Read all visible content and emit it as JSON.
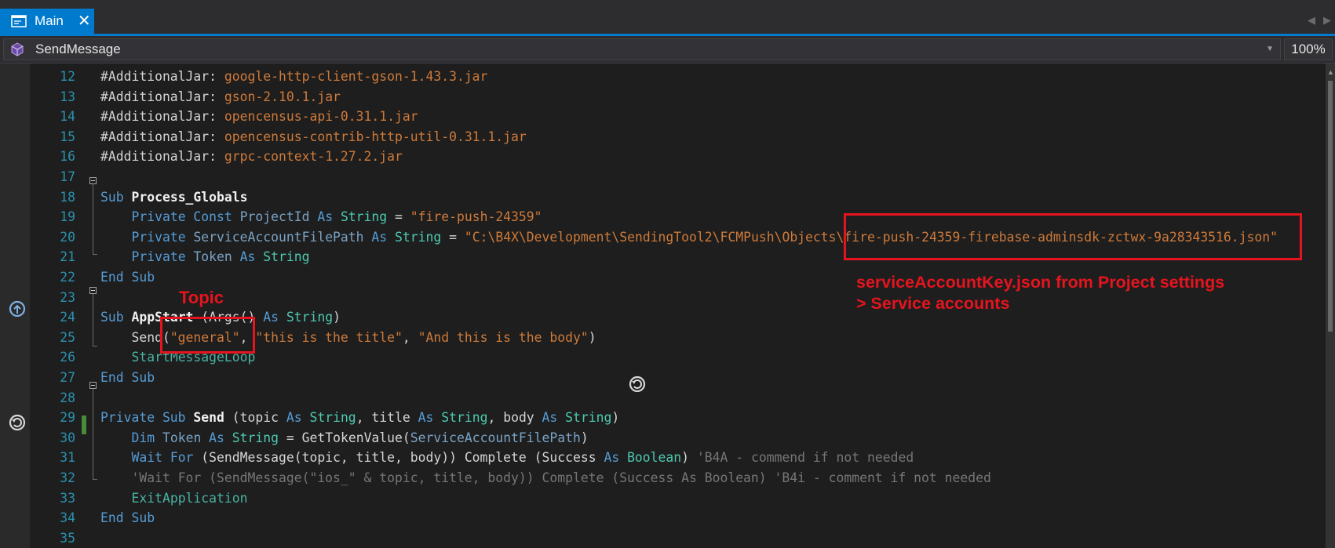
{
  "tab": {
    "label": "Main",
    "close": "✕"
  },
  "navbar": {
    "member": "SendMessage",
    "zoom": "100%"
  },
  "lines": [
    {
      "n": "12",
      "t": [
        [
          "dir",
          "#AdditionalJar"
        ],
        [
          "plain",
          ": "
        ],
        [
          "str",
          "google-http-client-gson-1.43.3.jar"
        ]
      ]
    },
    {
      "n": "13",
      "t": [
        [
          "dir",
          "#AdditionalJar"
        ],
        [
          "plain",
          ": "
        ],
        [
          "str",
          "gson-2.10.1.jar"
        ]
      ]
    },
    {
      "n": "14",
      "t": [
        [
          "dir",
          "#AdditionalJar"
        ],
        [
          "plain",
          ": "
        ],
        [
          "str",
          "opencensus-api-0.31.1.jar"
        ]
      ]
    },
    {
      "n": "15",
      "t": [
        [
          "dir",
          "#AdditionalJar"
        ],
        [
          "plain",
          ": "
        ],
        [
          "str",
          "opencensus-contrib-http-util-0.31.1.jar"
        ]
      ]
    },
    {
      "n": "16",
      "t": [
        [
          "dir",
          "#AdditionalJar"
        ],
        [
          "plain",
          ": "
        ],
        [
          "str",
          "grpc-context-1.27.2.jar"
        ]
      ]
    },
    {
      "n": "17",
      "t": []
    },
    {
      "n": "18",
      "t": [
        [
          "kw",
          "Sub "
        ],
        [
          "bold",
          "Process_Globals"
        ]
      ]
    },
    {
      "n": "19",
      "t": [
        [
          "plain",
          "    "
        ],
        [
          "kw",
          "Private Const "
        ],
        [
          "id",
          "ProjectId"
        ],
        [
          "kw",
          " As "
        ],
        [
          "ty",
          "String"
        ],
        [
          "plain",
          " = "
        ],
        [
          "str",
          "\"fire-push-24359\""
        ]
      ]
    },
    {
      "n": "20",
      "t": [
        [
          "plain",
          "    "
        ],
        [
          "kw",
          "Private "
        ],
        [
          "id",
          "ServiceAccountFilePath"
        ],
        [
          "kw",
          " As "
        ],
        [
          "ty",
          "String"
        ],
        [
          "plain",
          " = "
        ],
        [
          "str",
          "\"C:\\B4X\\Development\\SendingTool2\\FCMPush\\Objects\\fire-push-24359-firebase-adminsdk-zctwx-9a28343516.json\""
        ]
      ]
    },
    {
      "n": "21",
      "t": [
        [
          "plain",
          "    "
        ],
        [
          "kw",
          "Private "
        ],
        [
          "id",
          "Token"
        ],
        [
          "kw",
          " As "
        ],
        [
          "ty",
          "String"
        ]
      ]
    },
    {
      "n": "22",
      "t": [
        [
          "kw",
          "End Sub"
        ]
      ]
    },
    {
      "n": "23",
      "t": []
    },
    {
      "n": "24",
      "t": [
        [
          "kw",
          "Sub "
        ],
        [
          "bold",
          "AppStart"
        ],
        [
          "plain",
          " (Args() "
        ],
        [
          "kw",
          "As "
        ],
        [
          "ty",
          "String"
        ],
        [
          "plain",
          ")"
        ]
      ]
    },
    {
      "n": "25",
      "t": [
        [
          "plain",
          "    Send("
        ],
        [
          "str",
          "\"general\""
        ],
        [
          "plain",
          ", "
        ],
        [
          "str",
          "\"this is the title\""
        ],
        [
          "plain",
          ", "
        ],
        [
          "str",
          "\"And this is the body\""
        ],
        [
          "plain",
          ")"
        ]
      ]
    },
    {
      "n": "26",
      "t": [
        [
          "plain",
          "    "
        ],
        [
          "stmt",
          "StartMessageLoop"
        ]
      ]
    },
    {
      "n": "27",
      "t": [
        [
          "kw",
          "End Sub"
        ]
      ]
    },
    {
      "n": "28",
      "t": []
    },
    {
      "n": "29",
      "t": [
        [
          "kw",
          "Private Sub "
        ],
        [
          "bold",
          "Send"
        ],
        [
          "plain",
          " (topic "
        ],
        [
          "kw",
          "As "
        ],
        [
          "ty",
          "String"
        ],
        [
          "plain",
          ", title "
        ],
        [
          "kw",
          "As "
        ],
        [
          "ty",
          "String"
        ],
        [
          "plain",
          ", body "
        ],
        [
          "kw",
          "As "
        ],
        [
          "ty",
          "String"
        ],
        [
          "plain",
          ")"
        ]
      ]
    },
    {
      "n": "30",
      "t": [
        [
          "plain",
          "    "
        ],
        [
          "kw",
          "Dim "
        ],
        [
          "id",
          "Token"
        ],
        [
          "kw",
          " As "
        ],
        [
          "ty",
          "String"
        ],
        [
          "plain",
          " = GetTokenValue("
        ],
        [
          "id",
          "ServiceAccountFilePath"
        ],
        [
          "plain",
          ")"
        ]
      ]
    },
    {
      "n": "31",
      "t": [
        [
          "plain",
          "    "
        ],
        [
          "kw",
          "Wait For"
        ],
        [
          "plain",
          " (SendMessage(topic, title, body)) Complete (Success "
        ],
        [
          "kw",
          "As "
        ],
        [
          "ty",
          "Boolean"
        ],
        [
          "plain",
          ") "
        ],
        [
          "cm",
          "'B4A - commend if not needed"
        ]
      ]
    },
    {
      "n": "32",
      "t": [
        [
          "plain",
          "    "
        ],
        [
          "cm",
          "'Wait For (SendMessage(\"ios_\" & topic, title, body)) Complete (Success As Boolean) 'B4i - comment if not needed"
        ]
      ]
    },
    {
      "n": "33",
      "t": [
        [
          "plain",
          "    "
        ],
        [
          "stmt",
          "ExitApplication"
        ]
      ]
    },
    {
      "n": "34",
      "t": [
        [
          "kw",
          "End Sub"
        ]
      ]
    },
    {
      "n": "35",
      "t": []
    }
  ],
  "annotations": {
    "topic_label": "Topic",
    "key_line1": "serviceAccountKey.json from Project settings",
    "key_line2": "> Service accounts"
  },
  "colors": {
    "accent": "#007acc",
    "annotation": "#e5141e",
    "keyword": "#569cd6",
    "type": "#4ec9b0",
    "string": "#ce7a3a",
    "linenum": "#2b91af"
  }
}
